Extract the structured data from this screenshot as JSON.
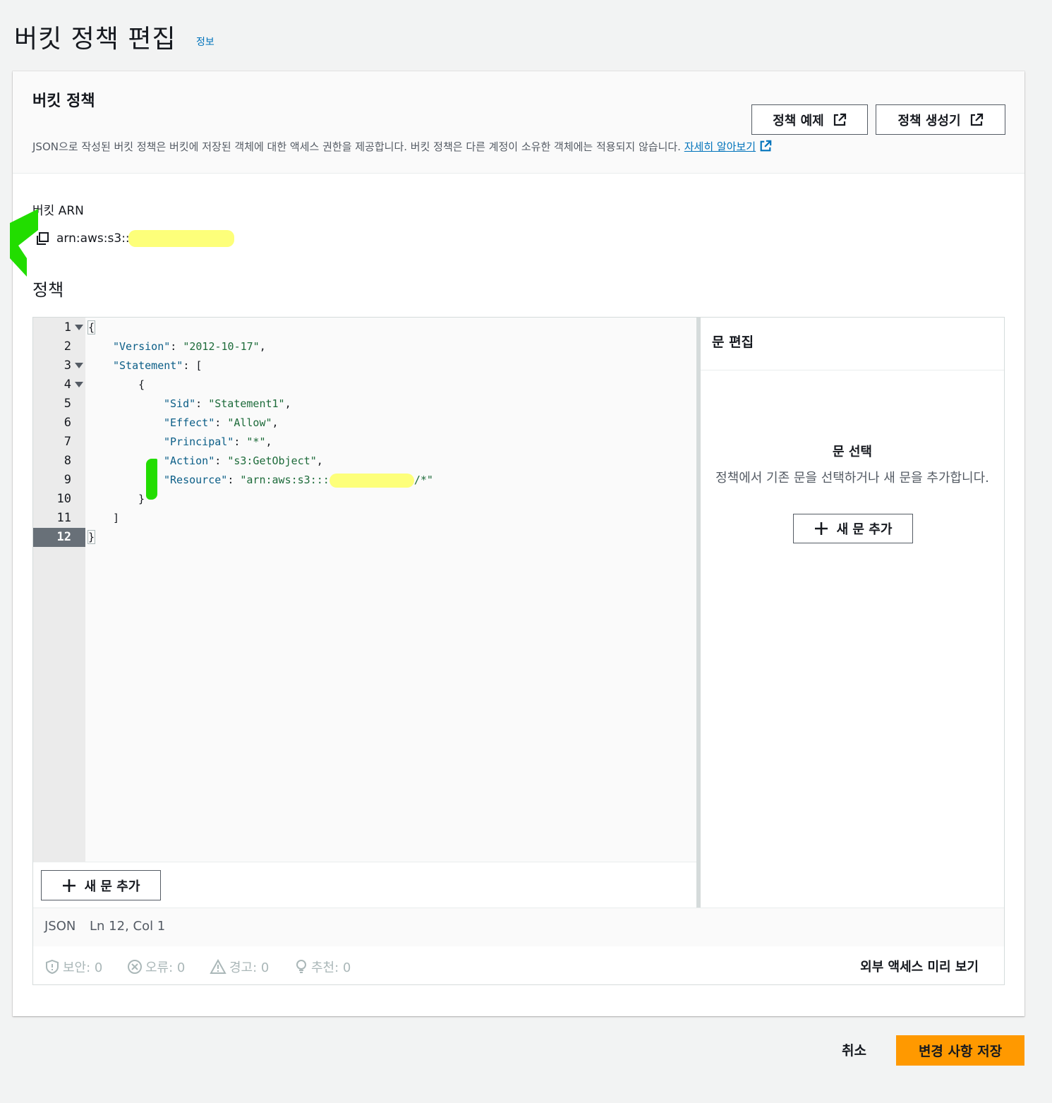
{
  "page": {
    "title": "버킷 정책 편집",
    "info_link": "정보"
  },
  "panel": {
    "title": "버킷 정책",
    "description": "JSON으로 작성된 버킷 정책은 버킷에 저장된 객체에 대한 액세스 권한을 제공합니다. 버킷 정책은 다른 계정이 소유한 객체에는 적용되지 않습니다.",
    "learn_more": "자세히 알아보기",
    "buttons": {
      "policy_examples": "정책 예제",
      "policy_generator": "정책 생성기"
    }
  },
  "arn": {
    "label": "버킷 ARN",
    "value": "arn:aws:s3::"
  },
  "policy": {
    "label": "정책",
    "line_numbers": [
      "1",
      "2",
      "3",
      "4",
      "5",
      "6",
      "7",
      "8",
      "9",
      "10",
      "11",
      "12"
    ],
    "code": {
      "l1": "{",
      "l2_key": "\"Version\"",
      "l2_sep": ": ",
      "l2_val": "\"2012-10-17\"",
      "l2_end": ",",
      "l3_key": "\"Statement\"",
      "l3_rest": ": [",
      "l4": "{",
      "l5_key": "\"Sid\"",
      "l5_sep": ": ",
      "l5_val": "\"Statement1\"",
      "l5_end": ",",
      "l6_key": "\"Effect\"",
      "l6_sep": ": ",
      "l6_val": "\"Allow\"",
      "l6_end": ",",
      "l7_key": "\"Principal\"",
      "l7_sep": ": ",
      "l7_val": "\"*\"",
      "l7_end": ",",
      "l8_key": "\"Action\"",
      "l8_sep": ": ",
      "l8_val": "\"s3:GetObject\"",
      "l8_end": ",",
      "l9_key": "\"Resource\"",
      "l9_sep": ": ",
      "l9_val_start": "\"arn:aws:s3:::",
      "l9_val_end": "/*\"",
      "l10": "}",
      "l11": "]",
      "l12": "}"
    },
    "add_statement": "새 문 추가"
  },
  "side_panel": {
    "title": "문 편집",
    "empty_title": "문 선택",
    "empty_desc": "정책에서 기존 문을 선택하거나 새 문을 추가합니다.",
    "add_statement": "새 문 추가"
  },
  "status": {
    "language": "JSON",
    "cursor": "Ln 12, Col 1"
  },
  "issues": {
    "security": "보안: 0",
    "errors": "오류: 0",
    "warnings": "경고: 0",
    "suggestions": "추천: 0",
    "preview": "외부 액세스 미리 보기"
  },
  "actions": {
    "cancel": "취소",
    "save": "변경 사항 저장"
  },
  "colors": {
    "primary": "#ff9900",
    "link": "#0073bb",
    "background": "#f2f3f3"
  }
}
